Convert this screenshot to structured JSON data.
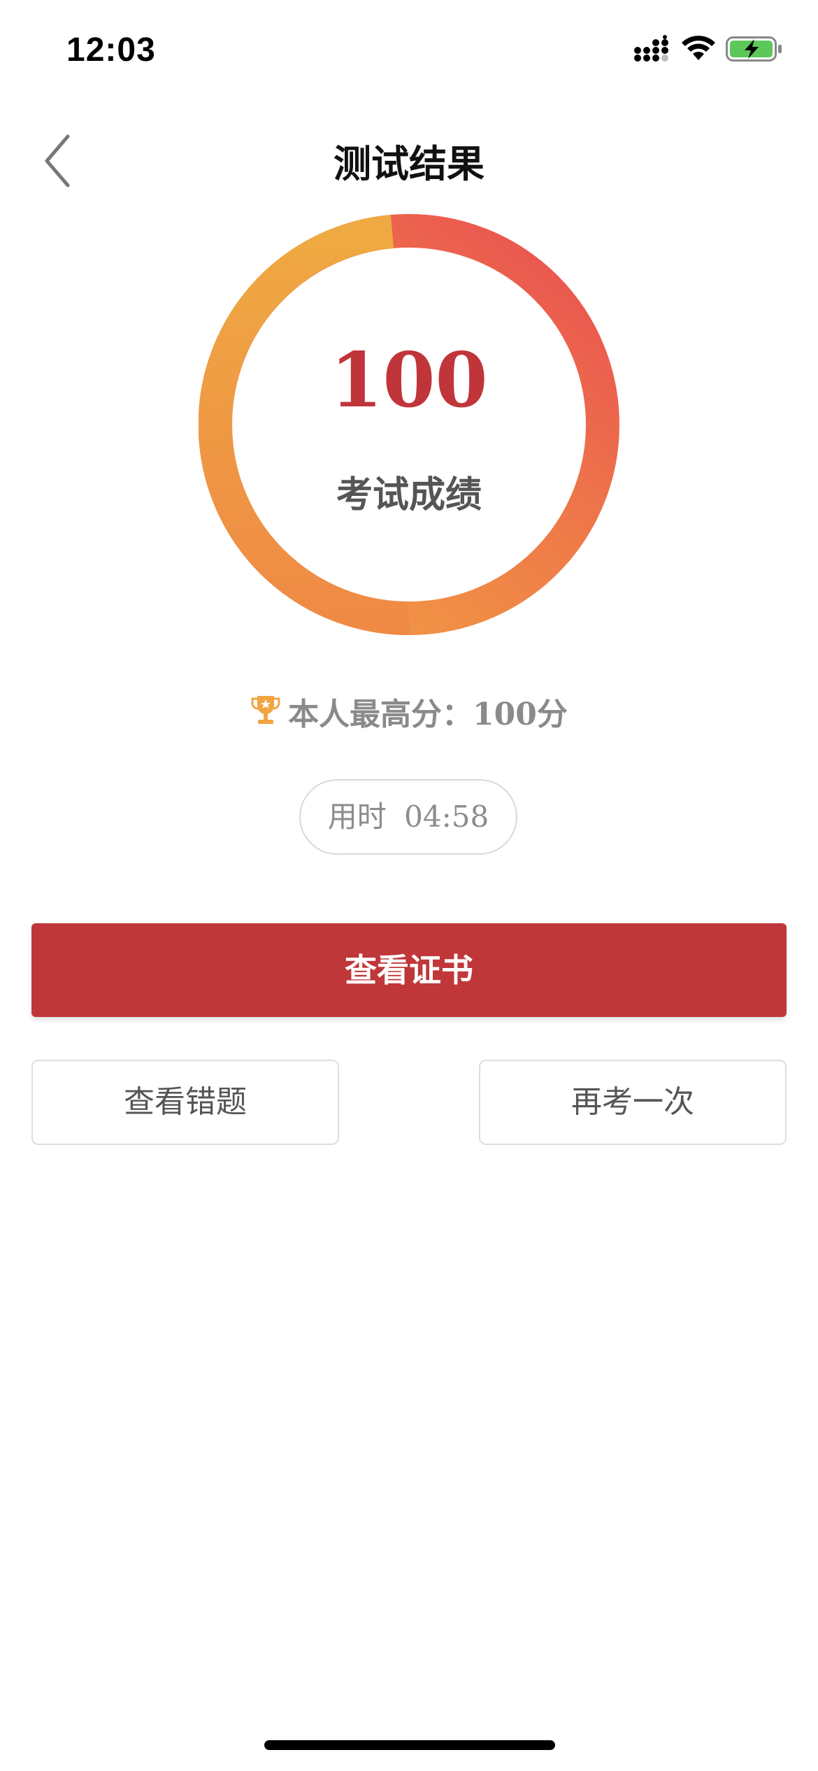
{
  "status_bar": {
    "time": "12:03",
    "icons": [
      "signal-icon",
      "wifi-icon",
      "battery-charging-icon"
    ],
    "battery_color": "#5cc85a"
  },
  "nav": {
    "title": "测试结果",
    "back_icon": "chevron-left-icon"
  },
  "score": {
    "value": "100",
    "label": "考试成绩",
    "ring_gradient": [
      "#e8524f",
      "#ef7d45",
      "#f0a542"
    ]
  },
  "best_score": {
    "icon": "trophy-icon",
    "text": "本人最高分：100分",
    "icon_color": "#f0a542"
  },
  "time_used": {
    "label": "用时",
    "value": "04:58"
  },
  "actions": {
    "certificate": "查看证书",
    "wrong_questions": "查看错题",
    "retry": "再考一次",
    "primary_color": "#c0373a"
  }
}
